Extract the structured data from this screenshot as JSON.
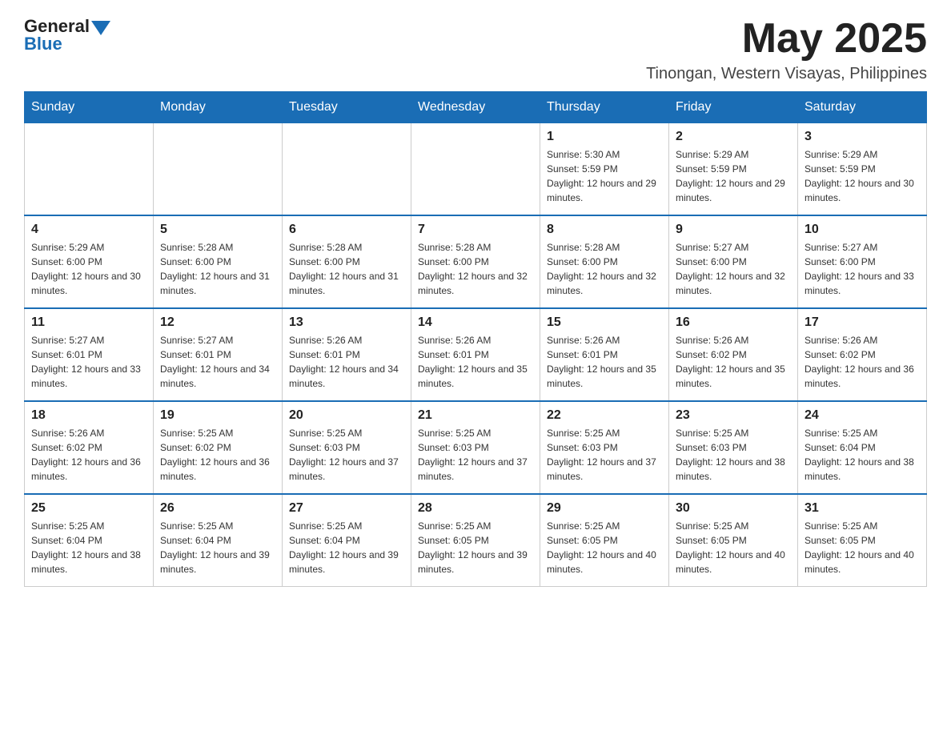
{
  "header": {
    "logo": {
      "text_general": "General",
      "text_blue": "Blue"
    },
    "month_title": "May 2025",
    "location": "Tinongan, Western Visayas, Philippines"
  },
  "days_of_week": [
    "Sunday",
    "Monday",
    "Tuesday",
    "Wednesday",
    "Thursday",
    "Friday",
    "Saturday"
  ],
  "weeks": [
    [
      {
        "day": "",
        "sunrise": "",
        "sunset": "",
        "daylight": ""
      },
      {
        "day": "",
        "sunrise": "",
        "sunset": "",
        "daylight": ""
      },
      {
        "day": "",
        "sunrise": "",
        "sunset": "",
        "daylight": ""
      },
      {
        "day": "",
        "sunrise": "",
        "sunset": "",
        "daylight": ""
      },
      {
        "day": "1",
        "sunrise": "Sunrise: 5:30 AM",
        "sunset": "Sunset: 5:59 PM",
        "daylight": "Daylight: 12 hours and 29 minutes."
      },
      {
        "day": "2",
        "sunrise": "Sunrise: 5:29 AM",
        "sunset": "Sunset: 5:59 PM",
        "daylight": "Daylight: 12 hours and 29 minutes."
      },
      {
        "day": "3",
        "sunrise": "Sunrise: 5:29 AM",
        "sunset": "Sunset: 5:59 PM",
        "daylight": "Daylight: 12 hours and 30 minutes."
      }
    ],
    [
      {
        "day": "4",
        "sunrise": "Sunrise: 5:29 AM",
        "sunset": "Sunset: 6:00 PM",
        "daylight": "Daylight: 12 hours and 30 minutes."
      },
      {
        "day": "5",
        "sunrise": "Sunrise: 5:28 AM",
        "sunset": "Sunset: 6:00 PM",
        "daylight": "Daylight: 12 hours and 31 minutes."
      },
      {
        "day": "6",
        "sunrise": "Sunrise: 5:28 AM",
        "sunset": "Sunset: 6:00 PM",
        "daylight": "Daylight: 12 hours and 31 minutes."
      },
      {
        "day": "7",
        "sunrise": "Sunrise: 5:28 AM",
        "sunset": "Sunset: 6:00 PM",
        "daylight": "Daylight: 12 hours and 32 minutes."
      },
      {
        "day": "8",
        "sunrise": "Sunrise: 5:28 AM",
        "sunset": "Sunset: 6:00 PM",
        "daylight": "Daylight: 12 hours and 32 minutes."
      },
      {
        "day": "9",
        "sunrise": "Sunrise: 5:27 AM",
        "sunset": "Sunset: 6:00 PM",
        "daylight": "Daylight: 12 hours and 32 minutes."
      },
      {
        "day": "10",
        "sunrise": "Sunrise: 5:27 AM",
        "sunset": "Sunset: 6:00 PM",
        "daylight": "Daylight: 12 hours and 33 minutes."
      }
    ],
    [
      {
        "day": "11",
        "sunrise": "Sunrise: 5:27 AM",
        "sunset": "Sunset: 6:01 PM",
        "daylight": "Daylight: 12 hours and 33 minutes."
      },
      {
        "day": "12",
        "sunrise": "Sunrise: 5:27 AM",
        "sunset": "Sunset: 6:01 PM",
        "daylight": "Daylight: 12 hours and 34 minutes."
      },
      {
        "day": "13",
        "sunrise": "Sunrise: 5:26 AM",
        "sunset": "Sunset: 6:01 PM",
        "daylight": "Daylight: 12 hours and 34 minutes."
      },
      {
        "day": "14",
        "sunrise": "Sunrise: 5:26 AM",
        "sunset": "Sunset: 6:01 PM",
        "daylight": "Daylight: 12 hours and 35 minutes."
      },
      {
        "day": "15",
        "sunrise": "Sunrise: 5:26 AM",
        "sunset": "Sunset: 6:01 PM",
        "daylight": "Daylight: 12 hours and 35 minutes."
      },
      {
        "day": "16",
        "sunrise": "Sunrise: 5:26 AM",
        "sunset": "Sunset: 6:02 PM",
        "daylight": "Daylight: 12 hours and 35 minutes."
      },
      {
        "day": "17",
        "sunrise": "Sunrise: 5:26 AM",
        "sunset": "Sunset: 6:02 PM",
        "daylight": "Daylight: 12 hours and 36 minutes."
      }
    ],
    [
      {
        "day": "18",
        "sunrise": "Sunrise: 5:26 AM",
        "sunset": "Sunset: 6:02 PM",
        "daylight": "Daylight: 12 hours and 36 minutes."
      },
      {
        "day": "19",
        "sunrise": "Sunrise: 5:25 AM",
        "sunset": "Sunset: 6:02 PM",
        "daylight": "Daylight: 12 hours and 36 minutes."
      },
      {
        "day": "20",
        "sunrise": "Sunrise: 5:25 AM",
        "sunset": "Sunset: 6:03 PM",
        "daylight": "Daylight: 12 hours and 37 minutes."
      },
      {
        "day": "21",
        "sunrise": "Sunrise: 5:25 AM",
        "sunset": "Sunset: 6:03 PM",
        "daylight": "Daylight: 12 hours and 37 minutes."
      },
      {
        "day": "22",
        "sunrise": "Sunrise: 5:25 AM",
        "sunset": "Sunset: 6:03 PM",
        "daylight": "Daylight: 12 hours and 37 minutes."
      },
      {
        "day": "23",
        "sunrise": "Sunrise: 5:25 AM",
        "sunset": "Sunset: 6:03 PM",
        "daylight": "Daylight: 12 hours and 38 minutes."
      },
      {
        "day": "24",
        "sunrise": "Sunrise: 5:25 AM",
        "sunset": "Sunset: 6:04 PM",
        "daylight": "Daylight: 12 hours and 38 minutes."
      }
    ],
    [
      {
        "day": "25",
        "sunrise": "Sunrise: 5:25 AM",
        "sunset": "Sunset: 6:04 PM",
        "daylight": "Daylight: 12 hours and 38 minutes."
      },
      {
        "day": "26",
        "sunrise": "Sunrise: 5:25 AM",
        "sunset": "Sunset: 6:04 PM",
        "daylight": "Daylight: 12 hours and 39 minutes."
      },
      {
        "day": "27",
        "sunrise": "Sunrise: 5:25 AM",
        "sunset": "Sunset: 6:04 PM",
        "daylight": "Daylight: 12 hours and 39 minutes."
      },
      {
        "day": "28",
        "sunrise": "Sunrise: 5:25 AM",
        "sunset": "Sunset: 6:05 PM",
        "daylight": "Daylight: 12 hours and 39 minutes."
      },
      {
        "day": "29",
        "sunrise": "Sunrise: 5:25 AM",
        "sunset": "Sunset: 6:05 PM",
        "daylight": "Daylight: 12 hours and 40 minutes."
      },
      {
        "day": "30",
        "sunrise": "Sunrise: 5:25 AM",
        "sunset": "Sunset: 6:05 PM",
        "daylight": "Daylight: 12 hours and 40 minutes."
      },
      {
        "day": "31",
        "sunrise": "Sunrise: 5:25 AM",
        "sunset": "Sunset: 6:05 PM",
        "daylight": "Daylight: 12 hours and 40 minutes."
      }
    ]
  ]
}
